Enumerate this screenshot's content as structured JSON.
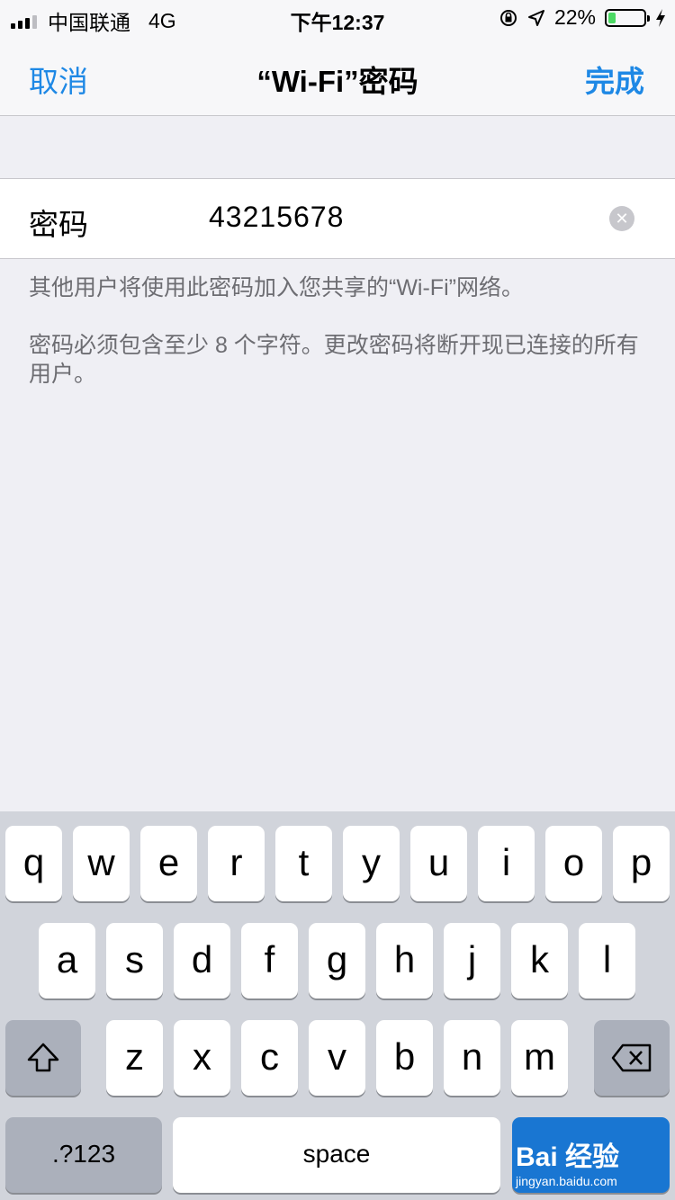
{
  "status_bar": {
    "carrier": "中国联通",
    "network": "4G",
    "time": "下午12:37",
    "battery_percent": "22%",
    "battery_level": 0.22
  },
  "nav": {
    "cancel_label": "取消",
    "title": "“Wi-Fi”密码",
    "done_label": "完成"
  },
  "password_row": {
    "label": "密码",
    "value": "43215678"
  },
  "notes": {
    "share_info": "其他用户将使用此密码加入您共享的“Wi-Fi”网络。",
    "requirement": "密码必须包含至少 8 个字符。更改密码将断开现已连接的所有用户。"
  },
  "keyboard": {
    "row1": [
      "q",
      "w",
      "e",
      "r",
      "t",
      "y",
      "u",
      "i",
      "o",
      "p"
    ],
    "row2": [
      "a",
      "s",
      "d",
      "f",
      "g",
      "h",
      "j",
      "k",
      "l"
    ],
    "row3": [
      "z",
      "x",
      "c",
      "v",
      "b",
      "n",
      "m"
    ],
    "numbers_label": ".?123",
    "space_label": "space",
    "watermark_brand": "Bai 经验",
    "watermark_url": "jingyan.baidu.com"
  },
  "colors": {
    "accent": "#1e88e5",
    "battery_fill": "#4cd964"
  }
}
